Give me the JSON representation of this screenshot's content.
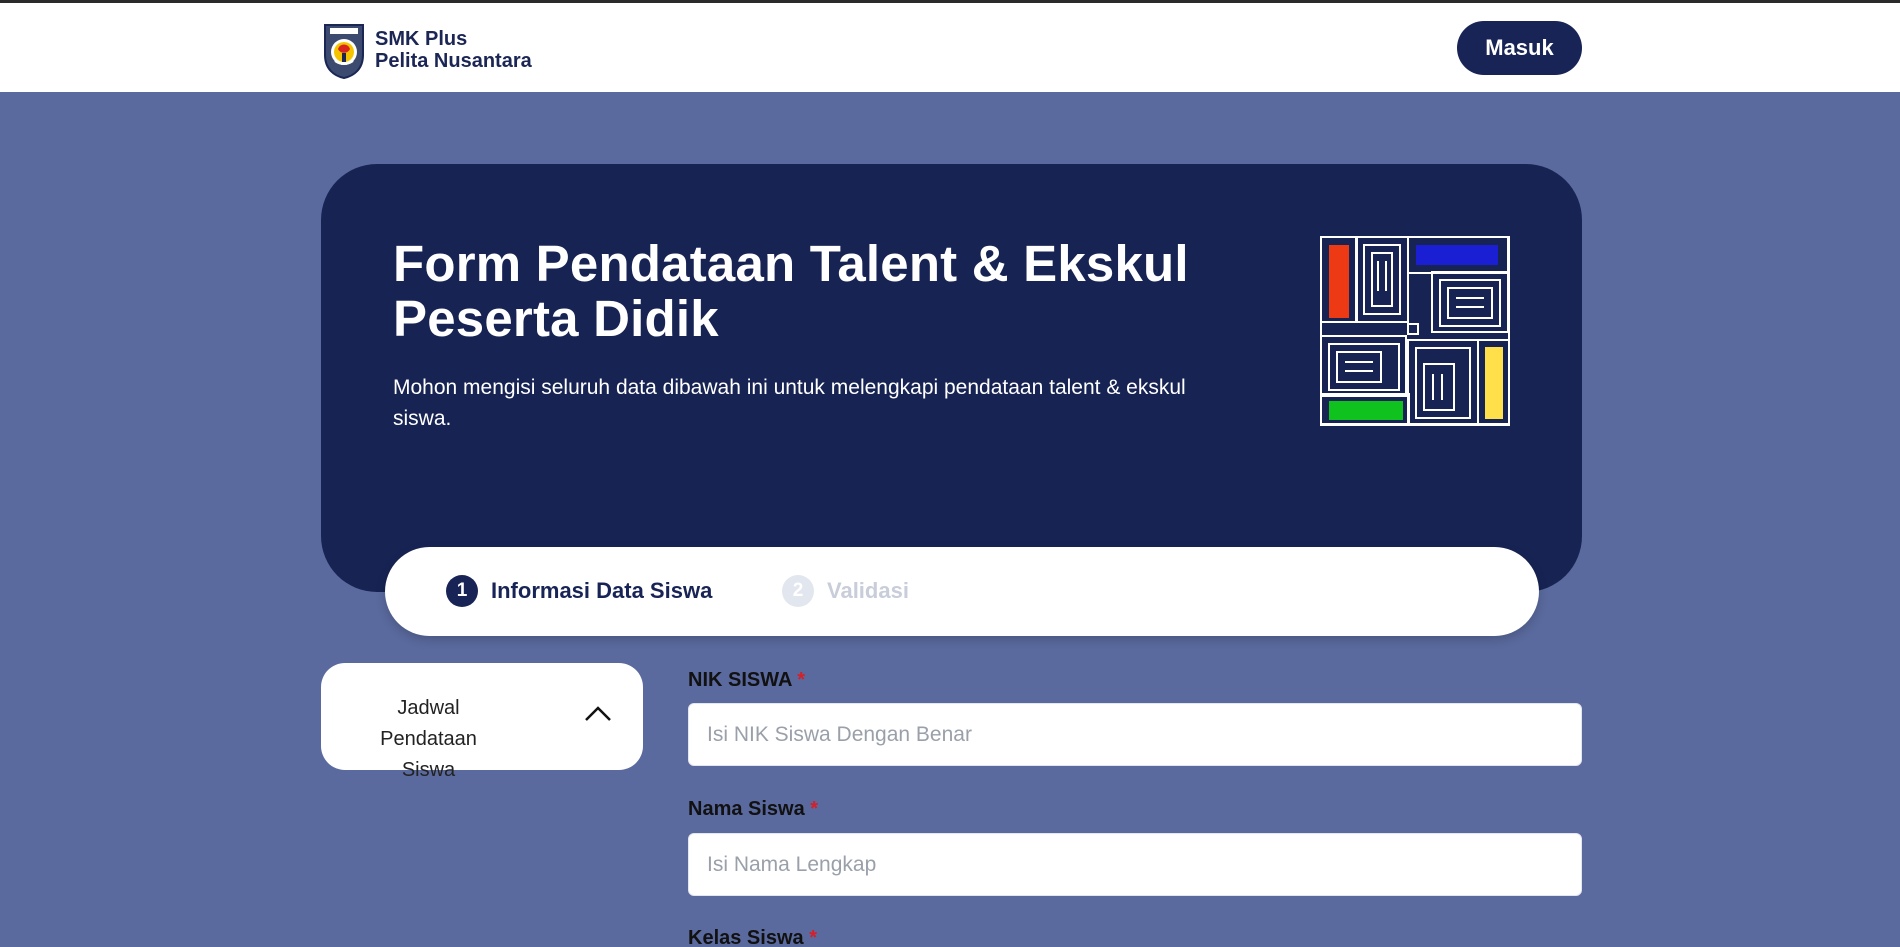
{
  "header": {
    "school_line1": "SMK Plus",
    "school_line2": "Pelita Nusantara",
    "login_button": "Masuk"
  },
  "hero": {
    "title": "Form Pendataan Talent & Ekskul Peserta Didik",
    "subtitle": "Mohon mengisi seluruh data dibawah ini untuk melengkapi pendataan talent & ekskul siswa."
  },
  "stepper": {
    "steps": [
      {
        "number": "1",
        "label": "Informasi Data Siswa",
        "active": true
      },
      {
        "number": "2",
        "label": "Validasi",
        "active": false
      }
    ]
  },
  "schedule_panel": {
    "label": "Jadwal Pendataan Siswa",
    "icon": "chevron-up-icon"
  },
  "form": {
    "nik": {
      "label": "NIK SISWA",
      "required_mark": "*",
      "placeholder": "Isi NIK Siswa Dengan Benar",
      "value": ""
    },
    "nama": {
      "label": "Nama Siswa",
      "required_mark": "*",
      "placeholder": "Isi Nama Lengkap",
      "value": ""
    },
    "kelas": {
      "label": "Kelas Siswa",
      "required_mark": "*"
    }
  },
  "colors": {
    "page_bg": "#5a6a9e",
    "navy": "#182456",
    "hero_bg": "#172353",
    "required": "#d61f26",
    "art_red": "#ee3a14",
    "art_blue": "#1a1fd4",
    "art_green": "#10c21e",
    "art_yellow": "#ffe04a"
  }
}
